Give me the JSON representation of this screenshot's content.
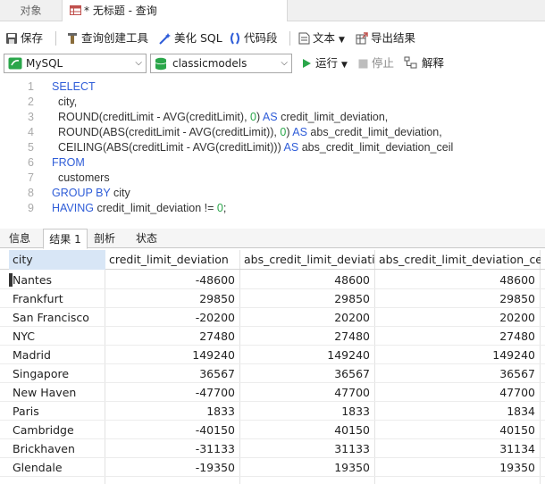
{
  "tabs": {
    "objects_label": "对象",
    "query_label": "* 无标题 - 查询"
  },
  "toolbar": {
    "save_label": "保存",
    "query_builder_label": "查询创建工具",
    "beautify_label": "美化 SQL",
    "snippet_label": "代码段",
    "text_label": "文本",
    "export_label": "导出结果"
  },
  "connection": {
    "server": "MySQL",
    "database": "classicmodels",
    "run_label": "运行",
    "stop_label": "停止",
    "explain_label": "解释",
    "colors": {
      "mysql": "#2aa64a",
      "db": "#2aa64a",
      "run": "#2aa64a"
    }
  },
  "editor": {
    "lines": [
      {
        "n": "1",
        "segments": [
          {
            "t": "SELECT",
            "c": "kw"
          }
        ]
      },
      {
        "n": "2",
        "segments": [
          {
            "t": "  city,",
            "c": "txt"
          }
        ]
      },
      {
        "n": "3",
        "segments": [
          {
            "t": "  ROUND(creditLimit - AVG(creditLimit), ",
            "c": "txt"
          },
          {
            "t": "0",
            "c": "num"
          },
          {
            "t": ") ",
            "c": "txt"
          },
          {
            "t": "AS",
            "c": "kw"
          },
          {
            "t": " credit_limit_deviation,",
            "c": "txt"
          }
        ]
      },
      {
        "n": "4",
        "segments": [
          {
            "t": "  ROUND(ABS(creditLimit - AVG(creditLimit)), ",
            "c": "txt"
          },
          {
            "t": "0",
            "c": "num"
          },
          {
            "t": ") ",
            "c": "txt"
          },
          {
            "t": "AS",
            "c": "kw"
          },
          {
            "t": " abs_credit_limit_deviation,",
            "c": "txt"
          }
        ]
      },
      {
        "n": "5",
        "segments": [
          {
            "t": "  CEILING(ABS(creditLimit - AVG(creditLimit))) ",
            "c": "txt"
          },
          {
            "t": "AS",
            "c": "kw"
          },
          {
            "t": " abs_credit_limit_deviation_ceil",
            "c": "txt"
          }
        ]
      },
      {
        "n": "6",
        "segments": [
          {
            "t": "FROM",
            "c": "kw"
          }
        ]
      },
      {
        "n": "7",
        "segments": [
          {
            "t": "  customers",
            "c": "txt"
          }
        ]
      },
      {
        "n": "8",
        "segments": [
          {
            "t": "GROUP BY",
            "c": "kw"
          },
          {
            "t": " city",
            "c": "txt"
          }
        ]
      },
      {
        "n": "9",
        "segments": [
          {
            "t": "HAVING",
            "c": "kw"
          },
          {
            "t": " credit_limit_deviation != ",
            "c": "txt"
          },
          {
            "t": "0",
            "c": "num"
          },
          {
            "t": ";",
            "c": "txt"
          }
        ]
      }
    ]
  },
  "result_tabs": [
    "信息",
    "结果 1",
    "剖析",
    "状态"
  ],
  "result": {
    "columns": [
      "city",
      "credit_limit_deviation",
      "abs_credit_limit_deviation",
      "abs_credit_limit_deviation_ceil"
    ],
    "rows": [
      [
        "Nantes",
        "-48600",
        "48600",
        "48600"
      ],
      [
        "Frankfurt",
        "29850",
        "29850",
        "29850"
      ],
      [
        "San Francisco",
        "-20200",
        "20200",
        "20200"
      ],
      [
        "NYC",
        "27480",
        "27480",
        "27480"
      ],
      [
        "Madrid",
        "149240",
        "149240",
        "149240"
      ],
      [
        "Singapore",
        "36567",
        "36567",
        "36567"
      ],
      [
        "New Haven",
        "-47700",
        "47700",
        "47700"
      ],
      [
        "Paris",
        "1833",
        "1833",
        "1834"
      ],
      [
        "Cambridge",
        "-40150",
        "40150",
        "40150"
      ],
      [
        "Brickhaven",
        "-31133",
        "31133",
        "31134"
      ],
      [
        "Glendale",
        "-19350",
        "19350",
        "19350"
      ]
    ]
  }
}
